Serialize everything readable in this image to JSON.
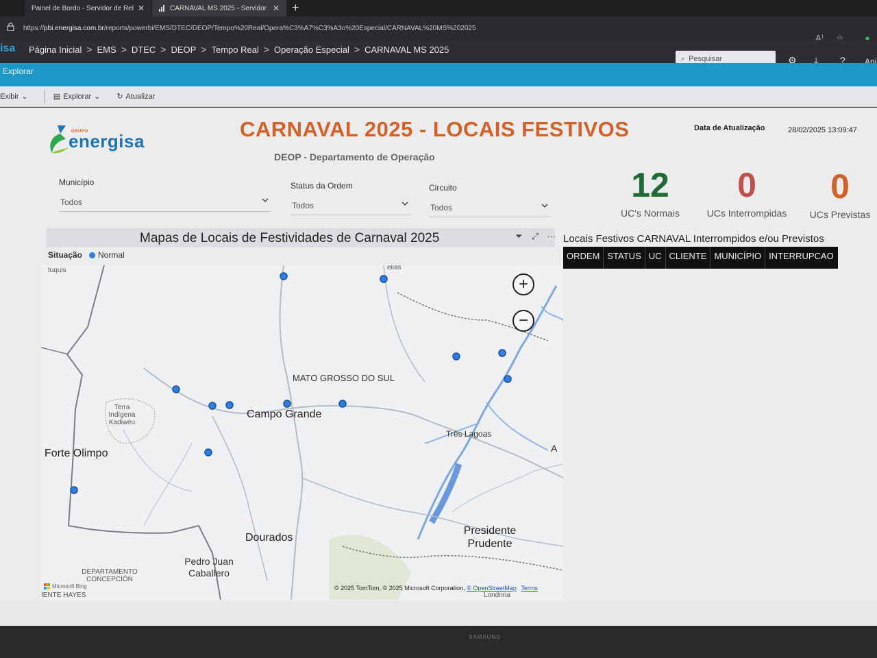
{
  "browser": {
    "tabs": [
      {
        "label": "Painel de Bordo - Servidor de Rel..."
      },
      {
        "label": "CARNAVAL MS 2025 - Servidor de..."
      }
    ],
    "url_prefix": "https://",
    "url_host": "pbi.energisa.com.br",
    "url_path": "/reports/powerbi/EMS/DTEC/DEOP/Tempo%20Real/Opera%C3%A7%C3%A3o%20Especial/CARNAVAL%20MS%202025"
  },
  "header": {
    "brand": "isa",
    "breadcrumbs": [
      "Página Inicial",
      "EMS",
      "DTEC",
      "DEOP",
      "Tempo Real",
      "Operação Especial",
      "CARNAVAL MS 2025"
    ],
    "search_placeholder": "Pesquisar",
    "user": "Ani"
  },
  "mode_bar": {
    "label": "Explorar"
  },
  "toolbar": {
    "view_label": "Exibir",
    "explore_label": "Explorar",
    "refresh_label": "Atualizar"
  },
  "report": {
    "logo_grupo": "GRUPO",
    "logo_name": "energisa",
    "title": "CARNAVAL 2025 - LOCAIS FESTIVOS",
    "subtitle": "DEOP - Departamento de Operação",
    "update_label": "Data de Atualização",
    "update_value": "28/02/2025 13:09:47"
  },
  "slicers": [
    {
      "label": "Município",
      "value": "Todos"
    },
    {
      "label": "Status da Ordem",
      "value": "Todos"
    },
    {
      "label": "Circuito",
      "value": "Todos"
    }
  ],
  "kpis": [
    {
      "value": "12",
      "label": "UC's Normais",
      "color": "#1e6b36"
    },
    {
      "value": "0",
      "label": "UCs Interrompidas",
      "color": "#c0504d"
    },
    {
      "value": "0",
      "label": "UCs Previstas",
      "color": "#d2622a"
    }
  ],
  "map": {
    "title": "Mapas de Locais de Festividades de Carnaval 2025",
    "legend_label": "Situação",
    "legend_value": "Normal",
    "legend_color": "#2f7fe0",
    "labels": {
      "state": "MATO GROSSO DO SUL",
      "campo_grande": "Campo Grande",
      "tres_lagoas": "Três Lagoas",
      "forte_olimpo": "Forte Olimpo",
      "dourados": "Dourados",
      "presidente_prudente": "Presidente Prudente",
      "pedro_juan": "Pedro Juan Caballero",
      "terra_indigena": "Terra Indígena Kadiwéu",
      "concepcion": "DEPARTAMENTO CONCEPCIÓN",
      "tuquis": "tuquis",
      "elias": "elias",
      "a_edge": "A",
      "londrina": "Londrina",
      "hayes": "IENTE HAYES"
    },
    "attribution": "© 2025 TomTom, © 2025 Microsoft Corporation,",
    "osm": "© OpenStreetMap",
    "terms": "Terms",
    "bing": "Microsoft Bing"
  },
  "table": {
    "title": "Locais Festivos CARNAVAL Interrompidos e/ou Previstos",
    "columns": [
      "ORDEM",
      "STATUS",
      "UC",
      "CLIENTE",
      "MUNICÍPIO",
      "INTERRUPCAO"
    ]
  },
  "monitor": {
    "brand": "SAMSUNG"
  }
}
